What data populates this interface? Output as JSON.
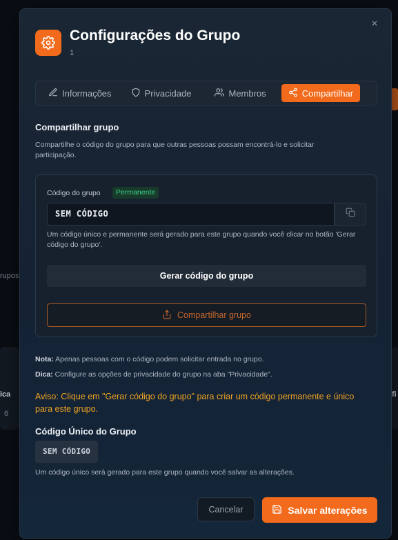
{
  "background": {
    "partial_text_1": "rupos",
    "partial_text_2": "ica",
    "partial_text_3": "6",
    "partial_text_4": "fi"
  },
  "modal": {
    "title": "Configurações do Grupo",
    "subtitle": "1",
    "close_label": "×",
    "accent_color": "#f26a1b"
  },
  "tabs": [
    {
      "label": "Informações",
      "icon": "pencil-icon",
      "active": false
    },
    {
      "label": "Privacidade",
      "icon": "shield-icon",
      "active": false
    },
    {
      "label": "Membros",
      "icon": "users-icon",
      "active": false
    },
    {
      "label": "Compartilhar",
      "icon": "share-icon",
      "active": true
    }
  ],
  "share": {
    "title": "Compartilhar grupo",
    "description": "Compartilhe o código do grupo para que outras pessoas possam encontrá-lo e solicitar participação.",
    "code_label": "Código do grupo",
    "badge": "Permanente",
    "code_value": "SEM CÓDIGO",
    "code_hint": "Um código único e permanente será gerado para este grupo quando você clicar no botão 'Gerar código do grupo'.",
    "generate_label": "Gerar código do grupo",
    "share_label": "Compartilhar grupo"
  },
  "notes": {
    "nota_label": "Nota:",
    "nota_text": " Apenas pessoas com o código podem solicitar entrada no grupo.",
    "dica_label": "Dica:",
    "dica_text": " Configure as opções de privacidade do grupo na aba \"Privacidade\"."
  },
  "warning": "Aviso: Clique em \"Gerar código do grupo\" para criar um código permanente e único para este grupo.",
  "unique": {
    "title": "Código Único do Grupo",
    "code": "SEM CÓDIGO",
    "hint": "Um código único será gerado para este grupo quando você salvar as alterações."
  },
  "footer": {
    "cancel_label": "Cancelar",
    "save_label": "Salvar alterações"
  }
}
